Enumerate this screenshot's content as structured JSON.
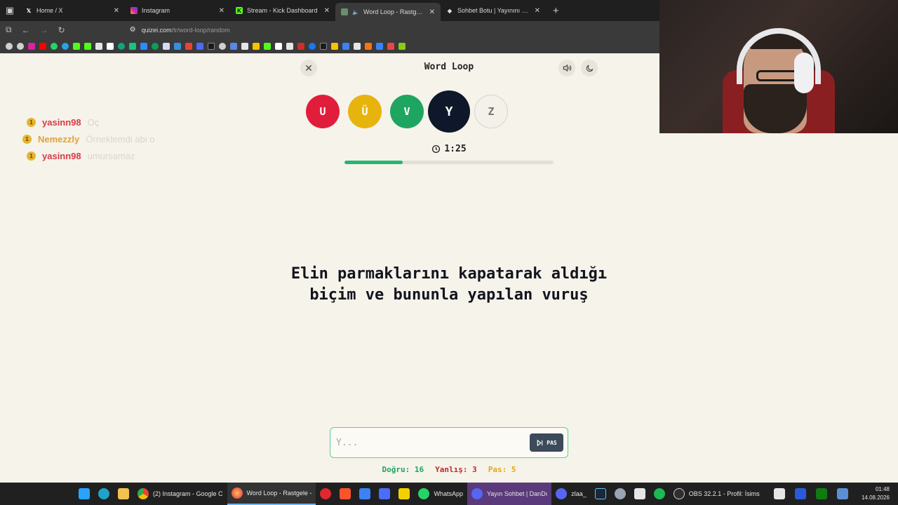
{
  "browser": {
    "tabs": [
      {
        "title": "Home / X",
        "favicon": "x-icon",
        "active": false
      },
      {
        "title": "Instagram",
        "favicon": "instagram-icon",
        "active": false
      },
      {
        "title": "Stream - Kick Dashboard",
        "favicon": "kick-icon",
        "active": false
      },
      {
        "title": "Word Loop - Rastgele - Qu",
        "favicon": "quizei-icon",
        "active": true
      },
      {
        "title": "Sohbet Botu | Yayınını güçlendi",
        "favicon": "bot-icon",
        "active": false
      }
    ],
    "url_host": "quizei.com",
    "url_path": "/tr/word-loop/random"
  },
  "chat": [
    {
      "user": "yasinn98",
      "message": "Oç",
      "user_color": "#d93a4a"
    },
    {
      "user": "Nemezzly",
      "message": "Örneklemdi abi o",
      "user_color": "#e0a23a"
    },
    {
      "user": "yasinn98",
      "message": "umursamaz",
      "user_color": "#d93a4a"
    }
  ],
  "chat_badge": "1",
  "game": {
    "title": "Word Loop",
    "letters": [
      {
        "char": "U",
        "color": "#e11d3c",
        "state": "done"
      },
      {
        "char": "Ü",
        "color": "#e6b40c",
        "state": "done"
      },
      {
        "char": "V",
        "color": "#1ea560",
        "state": "done"
      },
      {
        "char": "Y",
        "color": "#0f172a",
        "state": "current"
      },
      {
        "char": "Z",
        "color": "#f3f1e9",
        "state": "pending"
      }
    ],
    "timer": "1:25",
    "progress": 0.28,
    "question": "Elin parmaklarını kapatarak aldığı biçim ve bununla yapılan vuruş",
    "input_placeholder": "Y...",
    "pass_label": "PAS",
    "stats": {
      "correct_label": "Doğru: 16",
      "wrong_label": "Yanlış: 3",
      "pass_label": "Pas: 5"
    },
    "colors": {
      "correct": "#1ea560",
      "wrong": "#c0262d",
      "pass": "#e6a80c",
      "accent": "#22b573"
    }
  },
  "taskbar": {
    "items": [
      {
        "label": "",
        "icon": "windows-icon"
      },
      {
        "label": "",
        "icon": "edge-icon"
      },
      {
        "label": "",
        "icon": "folder-icon"
      },
      {
        "label": "(2) Instagram - Google C",
        "icon": "chrome-icon"
      },
      {
        "label": "Word Loop - Rastgele -",
        "icon": "firefox-icon"
      },
      {
        "label": "",
        "icon": "opera-icon"
      },
      {
        "label": "",
        "icon": "brave-icon"
      },
      {
        "label": "",
        "icon": "store-icon"
      },
      {
        "label": "",
        "icon": "calculator-icon"
      },
      {
        "label": "",
        "icon": "sticky-notes-icon"
      },
      {
        "label": "WhatsApp",
        "icon": "whatsapp-icon"
      },
      {
        "label": "Yayın Sohbet | DanDı",
        "icon": "discord-icon"
      },
      {
        "label": "zlaa_",
        "icon": "discord-icon"
      },
      {
        "label": "",
        "icon": "steam-icon"
      },
      {
        "label": "",
        "icon": "settings-icon"
      },
      {
        "label": "",
        "icon": "snipping-icon"
      },
      {
        "label": "",
        "icon": "spotify-icon"
      },
      {
        "label": "OBS 32.2.1 - Profil: İsims",
        "icon": "obs-icon"
      }
    ],
    "time": "01:48",
    "date": "14.08.2026"
  }
}
